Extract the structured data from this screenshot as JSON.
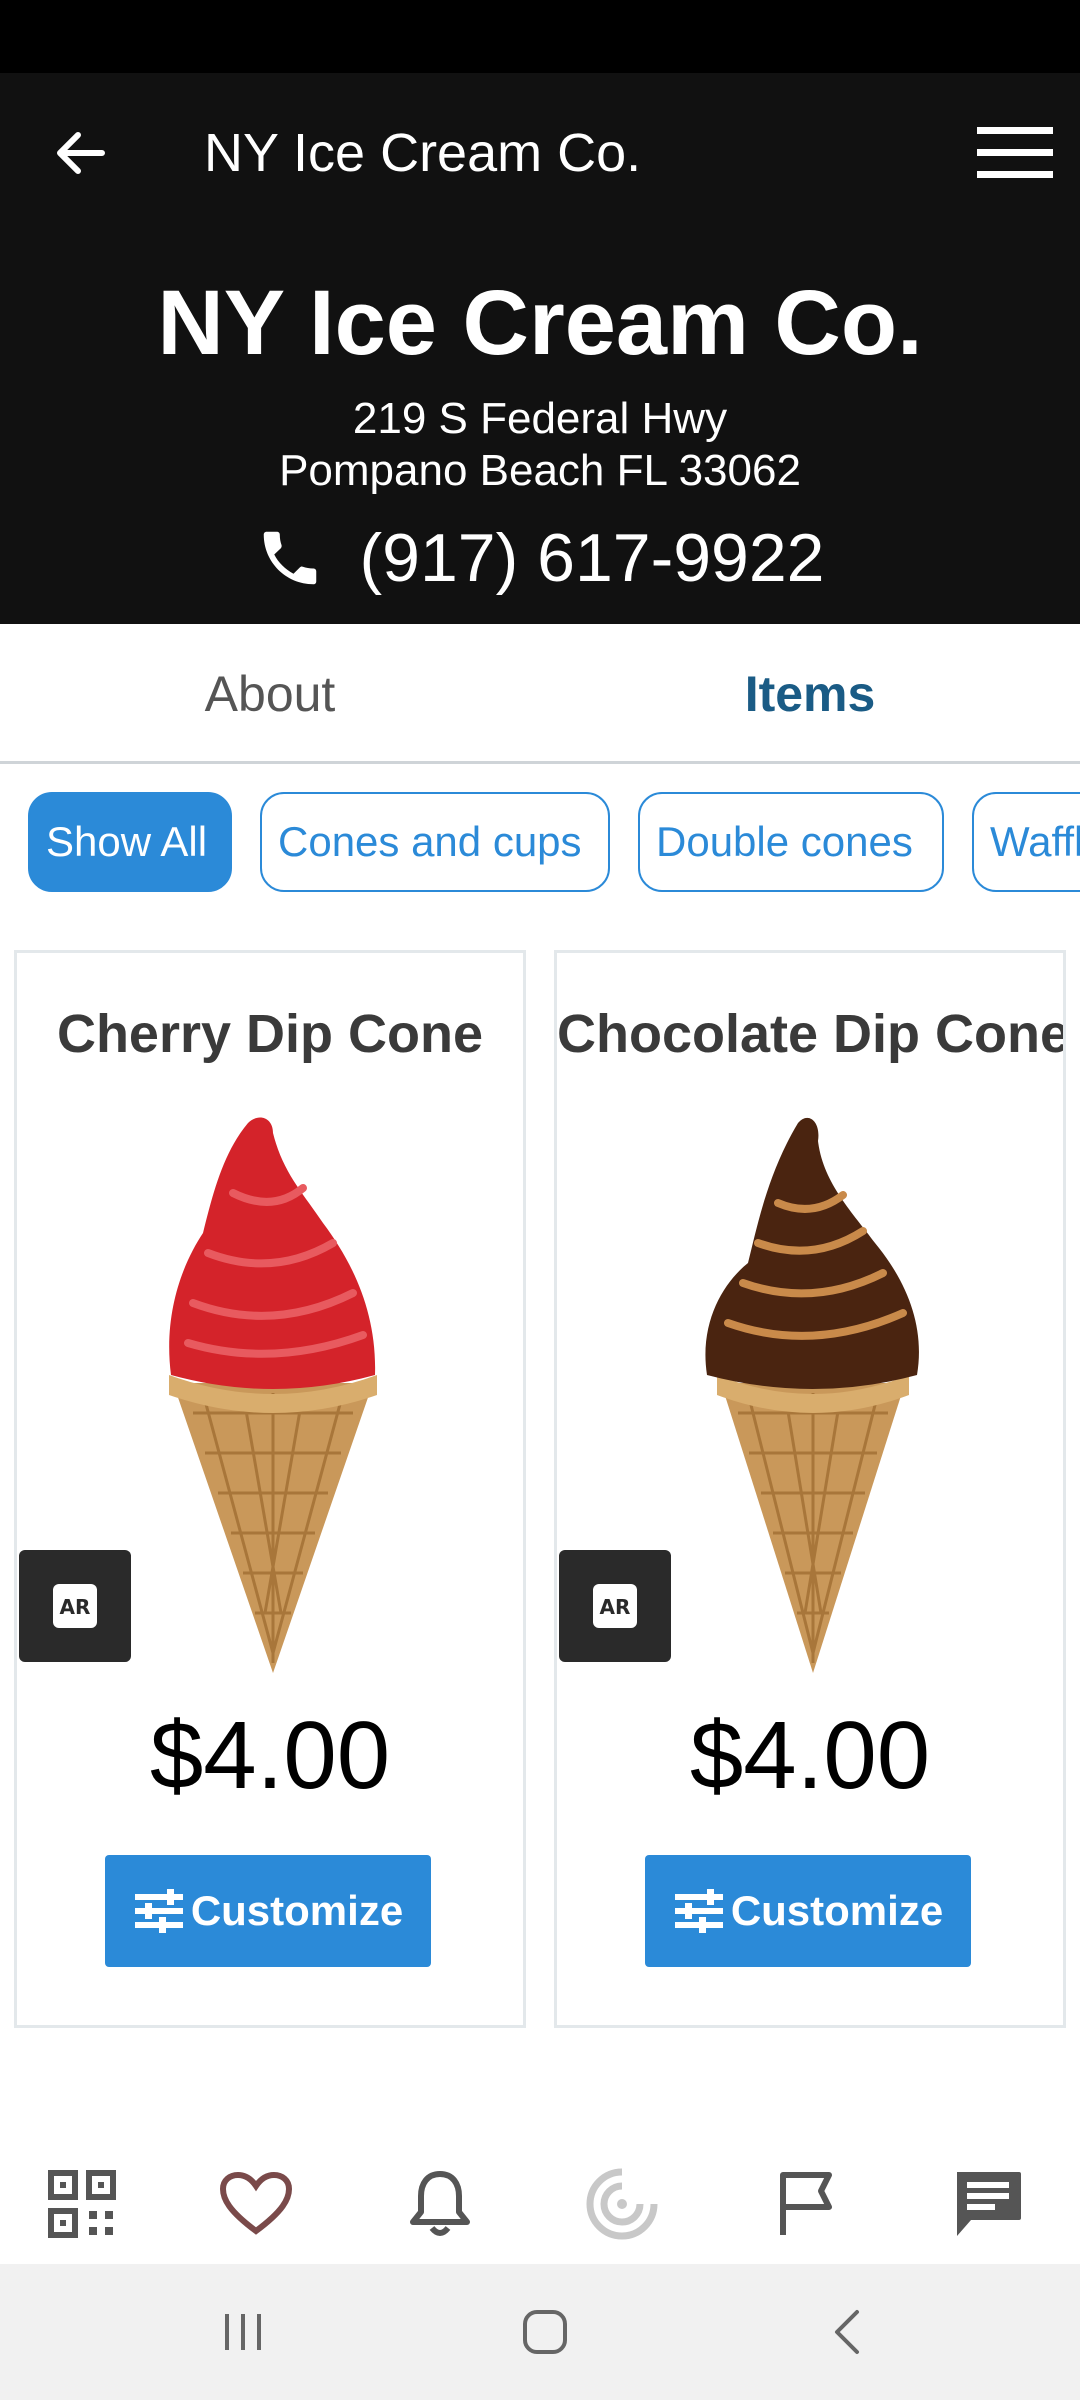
{
  "app_bar": {
    "title": "NY Ice Cream Co.",
    "back_icon": "arrow-left-icon",
    "menu_icon": "hamburger-menu-icon"
  },
  "store": {
    "name": "NY Ice Cream Co.",
    "address_line1": "219 S Federal Hwy",
    "address_line2": "Pompano Beach FL 33062",
    "phone": "(917) 617-9922",
    "phone_icon": "phone-icon"
  },
  "tabs": [
    {
      "label": "About",
      "active": false
    },
    {
      "label": "Items",
      "active": true
    }
  ],
  "filters": [
    {
      "label": "Show All",
      "active": true
    },
    {
      "label": "Cones and cups",
      "active": false
    },
    {
      "label": "Double cones",
      "active": false
    },
    {
      "label": "Waffle",
      "active": false
    }
  ],
  "items": [
    {
      "name": "Cherry Dip Cone",
      "price": "$4.00",
      "button_label": "Customize",
      "ar_label": "AR",
      "dip_color": "#d4232a"
    },
    {
      "name": "Chocolate Dip Cone",
      "price": "$4.00",
      "button_label": "Customize",
      "ar_label": "AR",
      "dip_color": "#4a2410"
    }
  ],
  "bottom_nav": [
    "qr-code-icon",
    "heart-icon",
    "bell-icon",
    "radar-icon",
    "flag-icon",
    "chat-icon"
  ],
  "colors": {
    "accent": "#2b8ad8",
    "header_bg": "#111111",
    "active_tab": "#1a5b85"
  }
}
